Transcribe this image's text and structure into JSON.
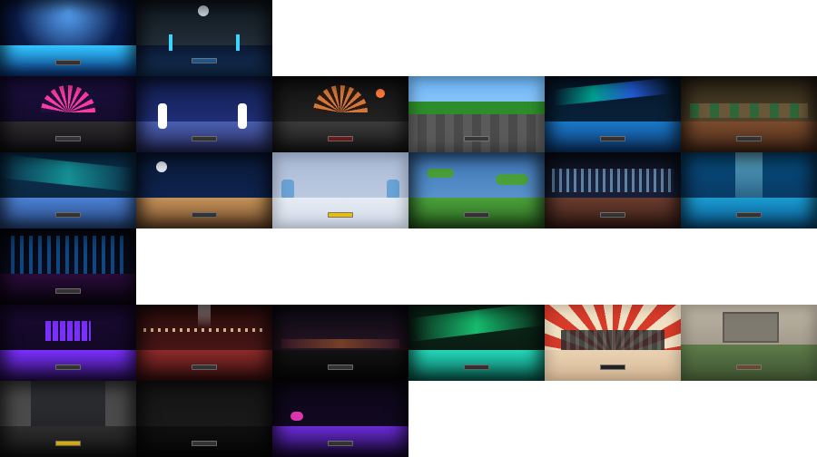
{
  "stages": [
    {
      "name": "blue-spotlight-disco",
      "sky": "#0b1c4a",
      "mid": "#1b4fd6",
      "floor": "#33c6ff"
    },
    {
      "name": "night-city-palms",
      "sky": "#111820",
      "mid": "#2d3c47",
      "floor": "#163a66"
    },
    {
      "name": "neon-fan-stage",
      "sky": "#1b1040",
      "mid": "#ff3a9e",
      "floor": "#2e2b2f"
    },
    {
      "name": "snowy-christmas-night",
      "sky": "#0f1c48",
      "mid": "#2b3a96",
      "floor": "#5a6dbf"
    },
    {
      "name": "halloween-night",
      "sky": "#101010",
      "mid": "#2f2f2f",
      "floor": "#3b3b3b"
    },
    {
      "name": "pixel-park",
      "sky": "#6bb5f5",
      "mid": "#2d8c2b",
      "floor": "#5a5a5a"
    },
    {
      "name": "aurora-pool-night",
      "sky": "#06162a",
      "mid": "#00c1a9",
      "floor": "#1a78c8"
    },
    {
      "name": "golden-hall",
      "sky": "#2d2416",
      "mid": "#6b5a3a",
      "floor": "#7a4b2d"
    },
    {
      "name": "aurora-ice-lake",
      "sky": "#0a3150",
      "mid": "#18b2b0",
      "floor": "#4b7fd1"
    },
    {
      "name": "moonlit-beach",
      "sky": "#0a1a3a",
      "mid": "#102a5a",
      "floor": "#c39157"
    },
    {
      "name": "white-studio",
      "sky": "#a9b9d6",
      "mid": "#c8d4e6",
      "floor": "#e6ecf4"
    },
    {
      "name": "floating-islands",
      "sky": "#3e78b9",
      "mid": "#6aa2d6",
      "floor": "#4aa03a"
    },
    {
      "name": "city-night-boardwalk",
      "sky": "#0b0f1c",
      "mid": "#1d2a4a",
      "floor": "#6a3b2e"
    },
    {
      "name": "underwater-light",
      "sky": "#064c7d",
      "mid": "#1a9bd0",
      "floor": "#0b5c95"
    },
    {
      "name": "neon-alley",
      "sky": "#050812",
      "mid": "#1a8cff",
      "floor": "#2a0b3a"
    },
    {
      "name": "purple-disco-stage",
      "sky": "#1a0b34",
      "mid": "#ff3fc7",
      "floor": "#7a30ff"
    },
    {
      "name": "red-theatre",
      "sky": "#2b0c0c",
      "mid": "#8c2a2a",
      "floor": "#612020"
    },
    {
      "name": "dark-lake-sunset",
      "sky": "#0b0b16",
      "mid": "#3a1a2a",
      "floor": "#121212"
    },
    {
      "name": "aurora-ice-rink",
      "sky": "#0b2a1a",
      "mid": "#1dff96",
      "floor": "#25d6b9"
    },
    {
      "name": "retro-city-sunburst",
      "sky": "#f2e2c5",
      "mid": "#d83a2a",
      "floor": "#e9d2b3"
    },
    {
      "name": "stone-ruins-field",
      "sky": "#bfb6a6",
      "mid": "#7e7a70",
      "floor": "#5f7b4a"
    },
    {
      "name": "city-street",
      "sky": "#303236",
      "mid": "#5a5a5a",
      "floor": "#2d2d2d"
    },
    {
      "name": "dark-studio",
      "sky": "#151515",
      "mid": "#1b1b1b",
      "floor": "#0f0f0f"
    },
    {
      "name": "purple-neon-stage",
      "sky": "#0c0716",
      "mid": "#2b1552",
      "floor": "#6a2bd6"
    }
  ]
}
